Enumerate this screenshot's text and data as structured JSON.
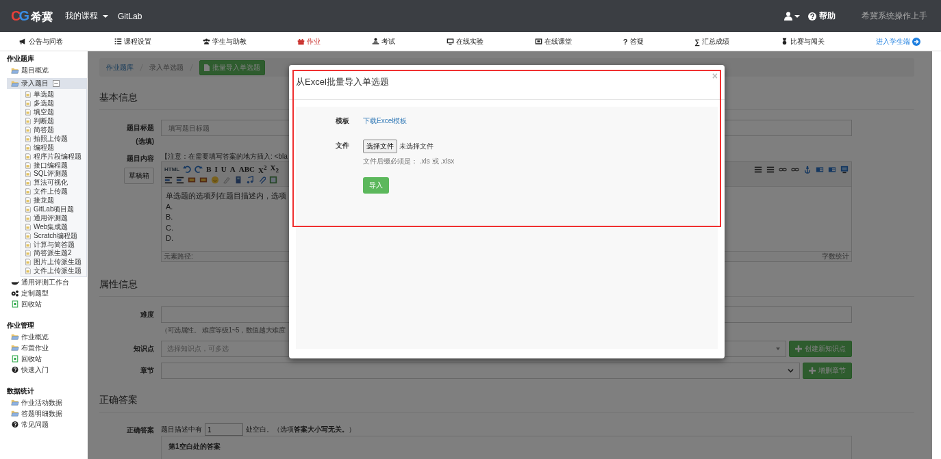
{
  "header": {
    "logo_mark": "CG",
    "logo_text": "希冀",
    "menu": [
      {
        "label": "我的课程",
        "dropdown": true
      },
      {
        "label": "GitLab",
        "dropdown": false
      }
    ],
    "user_dropdown": true,
    "help": "帮助",
    "guide": "希冀系统操作上手"
  },
  "tabs": [
    {
      "label": "公告与问卷",
      "kind": "megaphone",
      "selected": false
    },
    {
      "label": "课程设置",
      "kind": "list",
      "selected": false
    },
    {
      "label": "学生与助教",
      "kind": "users",
      "selected": false
    },
    {
      "label": "作业",
      "kind": "gift",
      "selected": true
    },
    {
      "label": "考试",
      "kind": "teacher",
      "selected": false
    },
    {
      "label": "在线实验",
      "kind": "monitor",
      "selected": false
    },
    {
      "label": "在线课堂",
      "kind": "screen",
      "selected": false
    },
    {
      "label": "答疑",
      "kind": "glyph",
      "glyph": "?",
      "selected": false
    },
    {
      "label": "汇总成绩",
      "kind": "glyph",
      "glyph": "∑",
      "selected": false
    },
    {
      "label": "比赛与闯关",
      "kind": "medal",
      "selected": false
    }
  ],
  "student_link": "进入学生端",
  "sidebar": [
    {
      "title": "作业题库",
      "items": [
        {
          "label": "题目概览",
          "kind": "folder",
          "selected": false
        },
        {
          "label": "录入题目",
          "kind": "folder",
          "selected": true,
          "expanded": true,
          "children": [
            {
              "label": "单选题",
              "selected": false
            },
            {
              "label": "多选题",
              "selected": false
            },
            {
              "label": "填空题",
              "selected": false
            },
            {
              "label": "判断题",
              "selected": false
            },
            {
              "label": "简答题",
              "selected": false
            },
            {
              "label": "拍照上传题",
              "selected": false
            },
            {
              "label": "编程题",
              "selected": false
            },
            {
              "label": "程序片段编程题",
              "selected": false
            },
            {
              "label": "接口编程题",
              "selected": false
            },
            {
              "label": "SQL评测题",
              "selected": false
            },
            {
              "label": "算法可视化",
              "selected": false
            },
            {
              "label": "文件上传题",
              "selected": false
            },
            {
              "label": "接龙题",
              "selected": false
            },
            {
              "label": "GitLab项目题",
              "selected": false
            },
            {
              "label": "通用评测题",
              "selected": false
            },
            {
              "label": "Web集成题",
              "selected": false
            },
            {
              "label": "Scratch编程题",
              "selected": false
            },
            {
              "label": "计算与简答题",
              "selected": false
            },
            {
              "label": "简答派生题2",
              "selected": false
            },
            {
              "label": "图片上传派生题",
              "selected": false
            },
            {
              "label": "文件上传派生题",
              "selected": false
            }
          ]
        },
        {
          "label": "通用评测工作台",
          "kind": "cup",
          "selected": false
        },
        {
          "label": "定制题型",
          "kind": "gears",
          "selected": false
        },
        {
          "label": "回收站",
          "kind": "trash",
          "selected": false
        }
      ]
    },
    {
      "title": "作业管理",
      "items": [
        {
          "label": "作业概览",
          "kind": "folder",
          "selected": false
        },
        {
          "label": "布置作业",
          "kind": "folder",
          "selected": false
        },
        {
          "label": "回收站",
          "kind": "trash",
          "selected": false
        },
        {
          "label": "快速入门",
          "kind": "help",
          "selected": false
        }
      ]
    },
    {
      "title": "数据统计",
      "items": [
        {
          "label": "作业活动数据",
          "kind": "folder",
          "selected": false
        },
        {
          "label": "答题明细数据",
          "kind": "folder",
          "selected": false
        },
        {
          "label": "常见问题",
          "kind": "help",
          "selected": false
        }
      ]
    }
  ],
  "breadcrumb": [
    "作业题库",
    "录入单选题"
  ],
  "breadcrumb_button": "批量导入单选题",
  "basic": {
    "heading": "基本信息",
    "title_label": "题目标题",
    "title_note": "(选填)",
    "title_placeholder": "填写题目标题",
    "content_label": "题目内容",
    "draft_button": "草稿箱",
    "notice": "【注意：在需要填写答案的地方插入: <bla",
    "editor": {
      "toolbar_text": [
        "HTML",
        "B",
        "I",
        "U",
        "A",
        "ABC",
        "X$^{2}$",
        "X$_{2}$"
      ],
      "body_lines": [
        "单选题的选项列在题目描述内，选项",
        "A.",
        "B.",
        "C.",
        "D."
      ],
      "path_label": "元素路径:",
      "word_count": "字数统计"
    }
  },
  "attributes": {
    "heading": "属性信息",
    "difficulty_label": "难度",
    "difficulty_hint": "（可选属性。 难度等级1~5，数值越大难度",
    "knowledge_label": "知识点",
    "knowledge_placeholder": "选择知识点，可多选",
    "knowledge_button": "创建新知识点",
    "chapter_label": "章节",
    "chapter_button": "增删章节"
  },
  "answer": {
    "heading": "正确答案",
    "label": "正确答案",
    "prefix": "题目描述中有",
    "blank_count": "1",
    "suffix": "处空白。（选项**答案大小写无关。**）",
    "blank_heading": "第1空白处的答案"
  },
  "dialog": {
    "title": "从Excel批量导入单选题",
    "close": "×",
    "template_label": "模板",
    "template_link": "下载Excel模板",
    "file_label": "文件",
    "file_button": "选择文件",
    "file_status": "未选择文件",
    "file_hint": "文件后缀必须是： .xls 或 .xlsx",
    "import_button": "导入"
  }
}
